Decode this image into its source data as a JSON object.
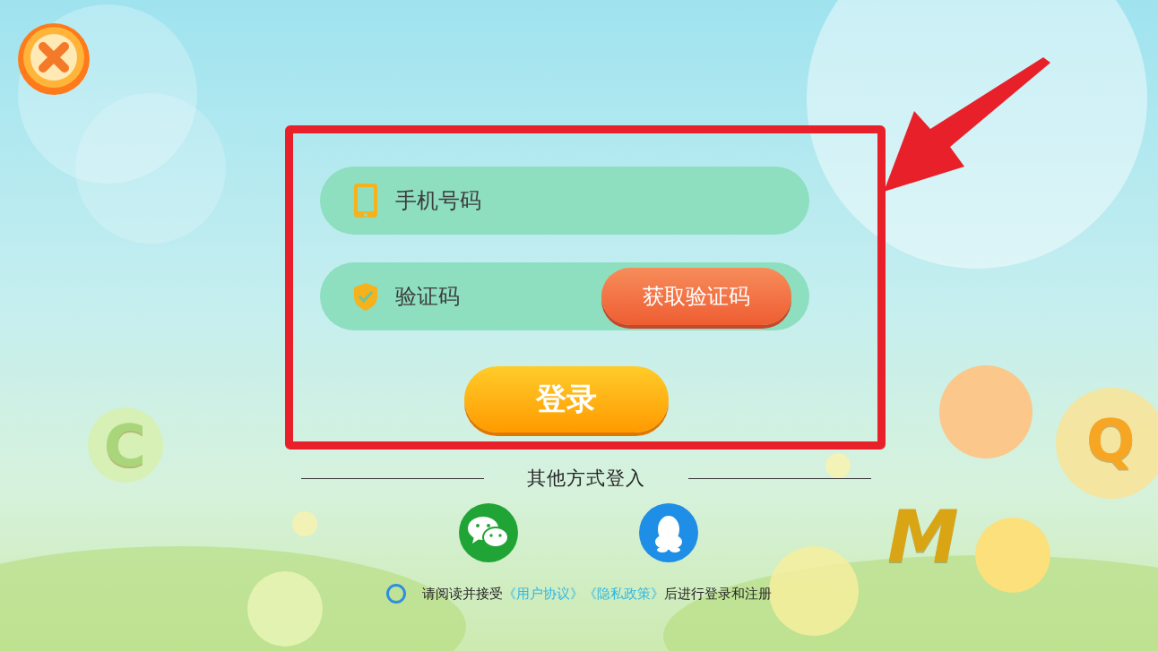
{
  "login_form": {
    "phone_field": {
      "placeholder": "手机号码"
    },
    "code_field": {
      "placeholder": "验证码"
    },
    "get_code_button": "获取验证码",
    "login_button": "登录"
  },
  "other_login": {
    "title": "其他方式登入",
    "methods": [
      {
        "kind": "wechat"
      },
      {
        "kind": "qq"
      }
    ]
  },
  "agreement": {
    "checked": false,
    "parts": [
      {
        "kind": "text",
        "text": "请阅读并接受"
      },
      {
        "kind": "link",
        "text": "《用户协议》"
      },
      {
        "kind": "link",
        "text": "《隐私政策》"
      },
      {
        "kind": "text",
        "text": "后进行登录和注册"
      }
    ]
  },
  "bubble_letters": [
    {
      "text": "C",
      "color": "#a9d67a"
    },
    {
      "text": "Q",
      "color": "#f6a623"
    },
    {
      "text": "M",
      "color": "#d9a514"
    }
  ]
}
